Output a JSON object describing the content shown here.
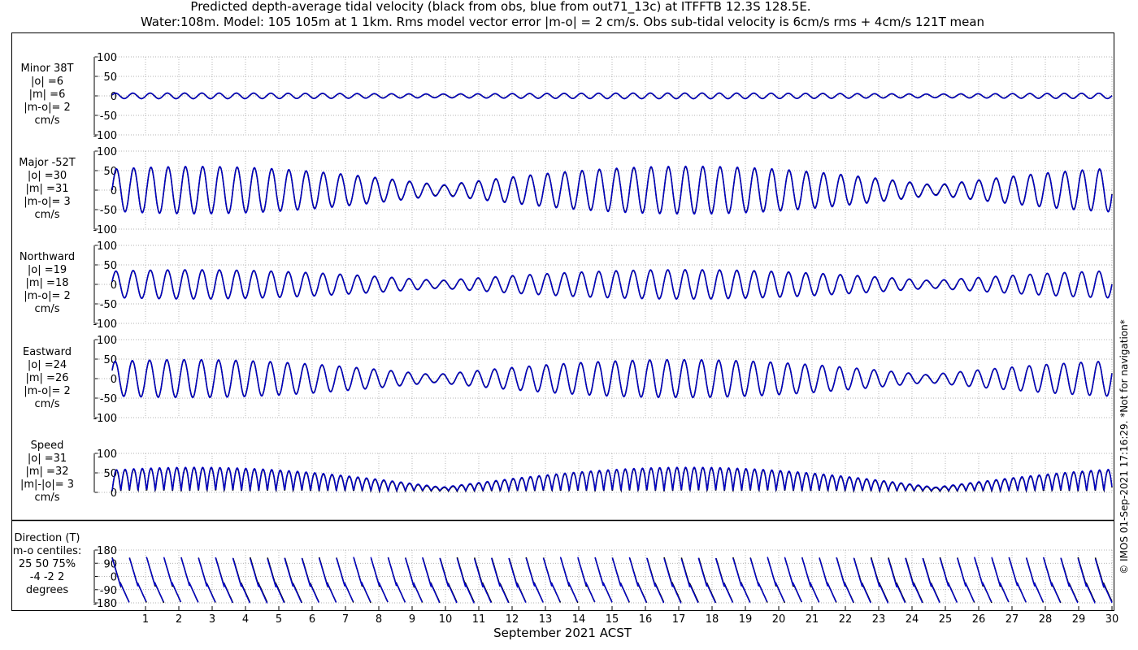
{
  "title_lines": [
    "Predicted depth-average tidal velocity (black from obs, blue from out71_13c) at ITFFTB 12.3S 128.5E.",
    "Water:108m. Model: 105 105m at 1 1km. Rms model vector error |m-o| = 2 cm/s. Obs sub-tidal velocity is 6cm/s rms + 4cm/s 121T mean"
  ],
  "copyright": "© IMOS 01-Sep-2021 17:16:29. *Not for navigation*",
  "colors": {
    "obs": "#000000",
    "model": "#0000cc",
    "grid": "#9a9a9a",
    "axis": "#000000"
  },
  "chart_data": [
    {
      "type": "line",
      "id": "minor",
      "label_lines": [
        "Minor 38T",
        "|o| =6",
        "|m| =6",
        "|m-o|= 2",
        "cm/s"
      ],
      "ylim": [
        -100,
        100
      ],
      "yticks": [
        100,
        50,
        0,
        -50,
        -100
      ],
      "xlim": [
        0,
        30
      ],
      "series": [],
      "tidal_model": {
        "amplitude_cm_s": 7,
        "spring_neap_depth": 0.35,
        "phase": 0.3,
        "model_offset": 0.5
      }
    },
    {
      "type": "line",
      "id": "major",
      "label_lines": [
        "Major -52T",
        "|o| =30",
        "|m| =31",
        "|m-o|= 3",
        "cm/s"
      ],
      "ylim": [
        -100,
        100
      ],
      "yticks": [
        100,
        50,
        0,
        -50,
        -100
      ],
      "xlim": [
        0,
        30
      ],
      "series": [],
      "tidal_model": {
        "amplitude_cm_s": 60,
        "spring_neap_depth": 0.8,
        "phase": 0.0,
        "model_offset": 1.5
      }
    },
    {
      "type": "line",
      "id": "northward",
      "label_lines": [
        "Northward",
        "|o| =19",
        "|m| =18",
        "|m-o|= 2",
        "cm/s"
      ],
      "ylim": [
        -100,
        100
      ],
      "yticks": [
        100,
        50,
        0,
        -50,
        -100
      ],
      "xlim": [
        0,
        30
      ],
      "series": [],
      "tidal_model": {
        "amplitude_cm_s": 37,
        "spring_neap_depth": 0.75,
        "phase": 0.2,
        "model_offset": 1.0
      }
    },
    {
      "type": "line",
      "id": "eastward",
      "label_lines": [
        "Eastward",
        "|o| =24",
        "|m| =26",
        "|m-o|= 2",
        "cm/s"
      ],
      "ylim": [
        -100,
        100
      ],
      "yticks": [
        100,
        50,
        0,
        -50,
        -100
      ],
      "xlim": [
        0,
        30
      ],
      "series": [],
      "tidal_model": {
        "amplitude_cm_s": 48,
        "spring_neap_depth": 0.8,
        "phase": 0.5,
        "model_offset": 1.0
      }
    },
    {
      "type": "line",
      "id": "speed",
      "label_lines": [
        "Speed",
        "|o| =31",
        "|m| =32",
        "|m|-|o|= 3",
        "cm/s"
      ],
      "ylim": [
        0,
        100
      ],
      "yticks": [
        100,
        50,
        0
      ],
      "xlim": [
        0,
        30
      ],
      "series": [],
      "tidal_model": {
        "amplitude_cm_s": 60,
        "spring_neap_depth": 0.85,
        "phase": 0.0,
        "model_offset": 1.5
      }
    },
    {
      "type": "line",
      "id": "direction",
      "label_lines": [
        "Direction (T)",
        "m-o centiles:",
        "25  50  75%",
        "-4 -2  2",
        "degrees"
      ],
      "ylim": [
        -180,
        180
      ],
      "yticks": [
        180,
        90,
        0,
        -90,
        -180
      ],
      "xlim": [
        0,
        30
      ],
      "series": [],
      "tidal_model": {
        "amplitude_cm_s": 0,
        "spring_neap_depth": 0,
        "phase": 0,
        "model_offset": 0
      }
    }
  ],
  "x_axis": {
    "ticks": [
      "1",
      "2",
      "3",
      "4",
      "5",
      "6",
      "7",
      "8",
      "9",
      "10",
      "11",
      "12",
      "13",
      "14",
      "15",
      "16",
      "17",
      "18",
      "19",
      "20",
      "21",
      "22",
      "23",
      "24",
      "25",
      "26",
      "27",
      "28",
      "29",
      "30"
    ],
    "label": "September 2021 ACST"
  }
}
